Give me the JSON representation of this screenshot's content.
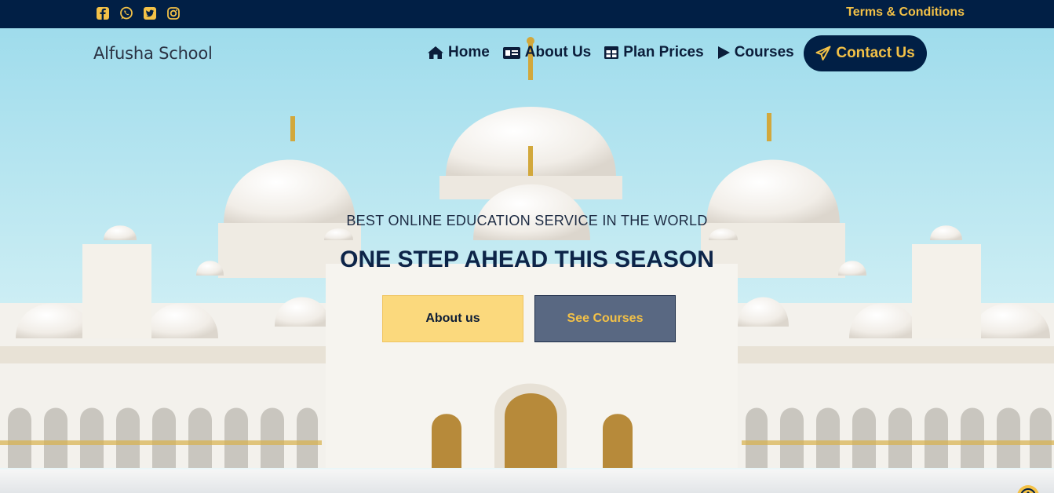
{
  "topbar": {
    "social_icons": [
      "facebook-icon",
      "whatsapp-icon",
      "twitter-icon",
      "instagram-icon"
    ],
    "terms_label": "Terms & Conditions"
  },
  "nav": {
    "brand": "Alfusha School",
    "items": [
      {
        "label": "Home",
        "icon": "home-icon"
      },
      {
        "label": "About Us",
        "icon": "id-card-icon"
      },
      {
        "label": "Plan Prices",
        "icon": "table-icon"
      },
      {
        "label": "Courses",
        "icon": "play-icon"
      }
    ],
    "contact_label": "Contact Us"
  },
  "hero": {
    "tagline": "BEST ONLINE EDUCATION SERVICE IN THE WORLD",
    "headline": "ONE STEP AHEAD THIS SEASON",
    "about_button": "About us",
    "courses_button": "See Courses"
  },
  "colors": {
    "navy": "#011f45",
    "gold": "#f3c147",
    "sky": "#aee3ef",
    "about_button_bg": "#fcd368",
    "courses_button_bg": "#3d4f6e"
  }
}
